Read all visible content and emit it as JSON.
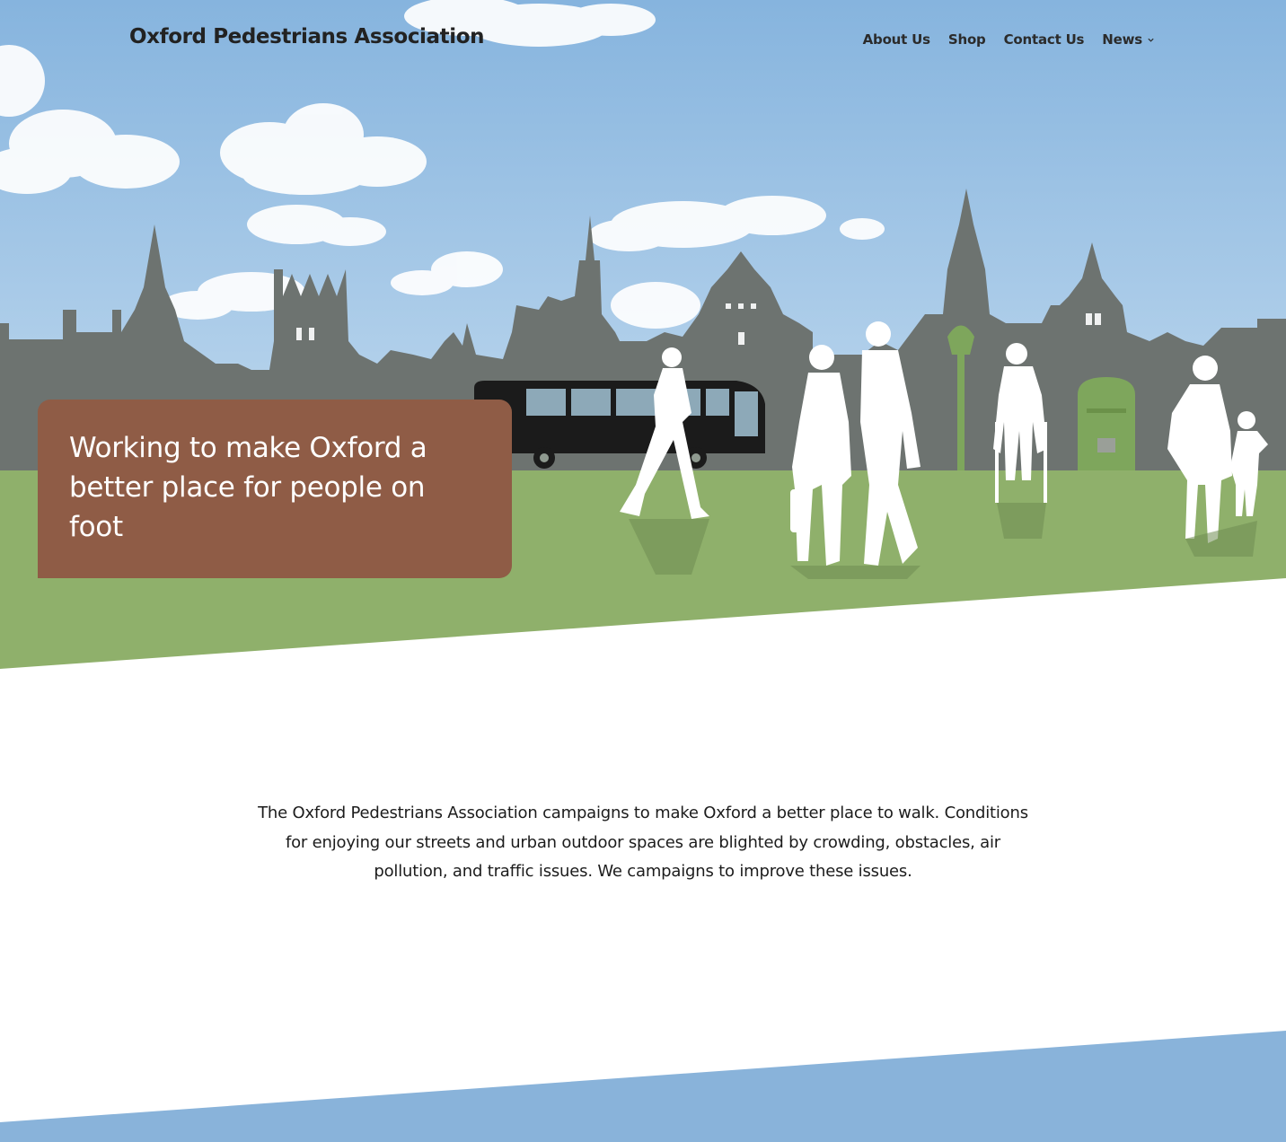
{
  "header": {
    "site_title": "Oxford Pedestrians Association"
  },
  "nav": {
    "items": [
      {
        "label": "About Us"
      },
      {
        "label": "Shop"
      },
      {
        "label": "Contact Us"
      },
      {
        "label": "News",
        "has_submenu": true
      }
    ]
  },
  "hero": {
    "heading": "Working to make Oxford a better place for people on foot"
  },
  "intro": {
    "text": "The Oxford Pedestrians Association campaigns to make Oxford a better place to walk. Conditions for enjoying our streets and urban outdoor spaces are blighted by crowding, obstacles, air pollution, and traffic issues. We campaigns to improve these issues."
  },
  "colors": {
    "sky_top": "#86b4de",
    "sky_bottom": "#b9d5ec",
    "skyline": "#6d7370",
    "grass": "#8fb06b",
    "callout_bg": "#8f5c46",
    "bottom_band": "#89b3da",
    "title_text": "#222222"
  },
  "icons": {
    "news_submenu": "chevron-down-icon"
  }
}
